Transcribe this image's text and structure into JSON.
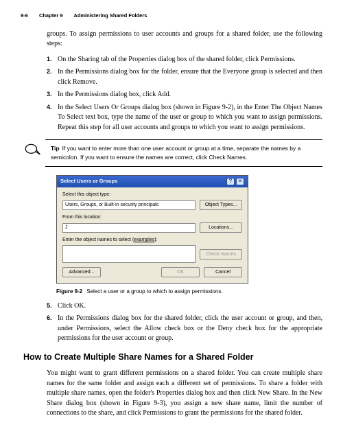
{
  "header": {
    "page": "9-6",
    "chapter": "Chapter 9",
    "title": "Administering Shared Folders"
  },
  "intro": "groups. To assign permissions to user accounts and groups for a shared folder, use the following steps:",
  "steps1": [
    "On the Sharing tab of the Properties dialog box of the shared folder, click Permissions.",
    "In the Permissions dialog box for the folder, ensure that the Everyone group is selected and then click Remove.",
    "In the Permissions dialog box, click Add.",
    "In the Select Users Or Groups dialog box (shown in Figure 9-2), in the Enter The Object Names To Select text box, type the name of the user or group to which you want to assign permissions. Repeat this step for all user accounts and groups to which you want to assign permissions."
  ],
  "tip": {
    "label": "Tip",
    "text": "If you want to enter more than one user account or group at a time, separate the names by a semicolon. If you want to ensure the names are correct, click Check Names."
  },
  "dialog": {
    "title": "Select Users or Groups",
    "lbl_type": "Select this object type:",
    "val_type": "Users, Groups, or Built-in security principals",
    "btn_type": "Object Types...",
    "lbl_loc": "From this location:",
    "val_loc": "J",
    "btn_loc": "Locations...",
    "lbl_names_pre": "Enter the object names to select (",
    "lbl_names_link": "examples",
    "lbl_names_post": "):",
    "btn_check": "Check Names",
    "btn_adv": "Advanced...",
    "btn_ok": "OK",
    "btn_cancel": "Cancel"
  },
  "figcap": {
    "fig": "Figure 9-2",
    "txt": "Select a user or a group to which to assign permissions."
  },
  "steps2": [
    "Click OK.",
    "In the Permissions dialog box for the shared folder, click the user account or group, and then, under Permissions, select the Allow check box or the Deny check box for the appropriate permissions for the user account or group."
  ],
  "h2": "How to Create Multiple Share Names for a Shared Folder",
  "body2": "You might want to grant different permissions on a shared folder. You can create multiple share names for the same folder and assign each a different set of permissions. To share a folder with multiple share names, open the folder's Properties dialog box and then click New Share. In the New Share dialog box (shown in Figure 9-3), you assign a new share name, limit the number of connections to the share, and click Permissions to grant the permissions for the shared folder."
}
